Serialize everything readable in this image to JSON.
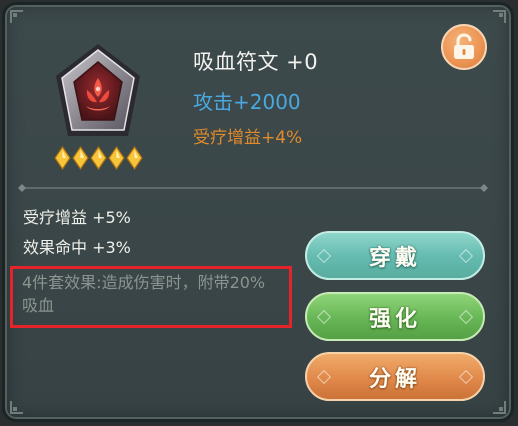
{
  "item": {
    "name": "吸血符文 +0",
    "main_stat": "攻击+2000",
    "sub_stat": "受疗增益+4%",
    "star_count": 5,
    "icon": "blood-rune-icon"
  },
  "attributes": [
    "受疗增益 +5%",
    "效果命中 +3%"
  ],
  "set_effect": "4件套效果:造成伤害时，附带20%吸血",
  "buttons": {
    "wear": "穿戴",
    "enhance": "强化",
    "decompose": "分解"
  },
  "lock": {
    "icon": "unlocked-padlock-icon"
  },
  "colors": {
    "main_stat": "#4aa8df",
    "sub_stat": "#e08a2c",
    "set_effect_inactive": "#8c9490",
    "highlight_box": "#e3242b",
    "wear_button": "#66bcb1",
    "enhance_button": "#67b656",
    "decompose_button": "#e0894a",
    "lock_button": "#ec9352"
  }
}
